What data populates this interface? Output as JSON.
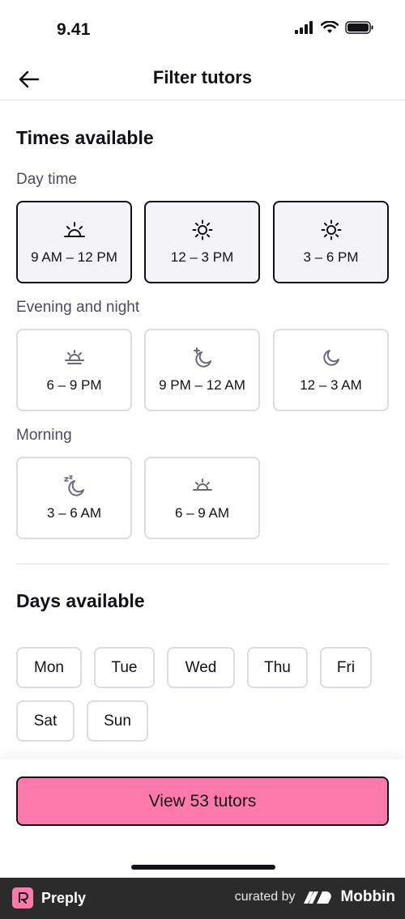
{
  "status": {
    "time": "9.41"
  },
  "nav": {
    "title": "Filter tutors"
  },
  "times": {
    "title": "Times available",
    "day": {
      "label": "Day time",
      "slots": [
        {
          "label": "9 AM – 12 PM",
          "icon": "sunrise-icon",
          "selected": true
        },
        {
          "label": "12 – 3 PM",
          "icon": "sun-icon",
          "selected": true
        },
        {
          "label": "3 – 6 PM",
          "icon": "sun-icon",
          "selected": true
        }
      ]
    },
    "evening": {
      "label": "Evening and night",
      "slots": [
        {
          "label": "6 – 9 PM",
          "icon": "sunset-icon",
          "selected": false
        },
        {
          "label": "9 PM – 12 AM",
          "icon": "moon-star-icon",
          "selected": false
        },
        {
          "label": "12 – 3 AM",
          "icon": "moon-icon",
          "selected": false
        }
      ]
    },
    "morning": {
      "label": "Morning",
      "slots": [
        {
          "label": "3 – 6 AM",
          "icon": "moon-sleep-icon",
          "selected": false
        },
        {
          "label": "6 – 9 AM",
          "icon": "sunrise-icon",
          "selected": false
        }
      ]
    }
  },
  "days": {
    "title": "Days available",
    "items": [
      "Mon",
      "Tue",
      "Wed",
      "Thu",
      "Fri",
      "Sat",
      "Sun"
    ]
  },
  "cta": {
    "label": "View 53 tutors"
  },
  "footer": {
    "brand": "Preply",
    "curated": "curated by",
    "mobbin": "Mobbin"
  },
  "colors": {
    "accent": "#ff7aac",
    "text": "#121117",
    "border": "#dcdce5",
    "selected_bg": "#f4f4f8",
    "footer_bg": "#2b2b2b"
  }
}
